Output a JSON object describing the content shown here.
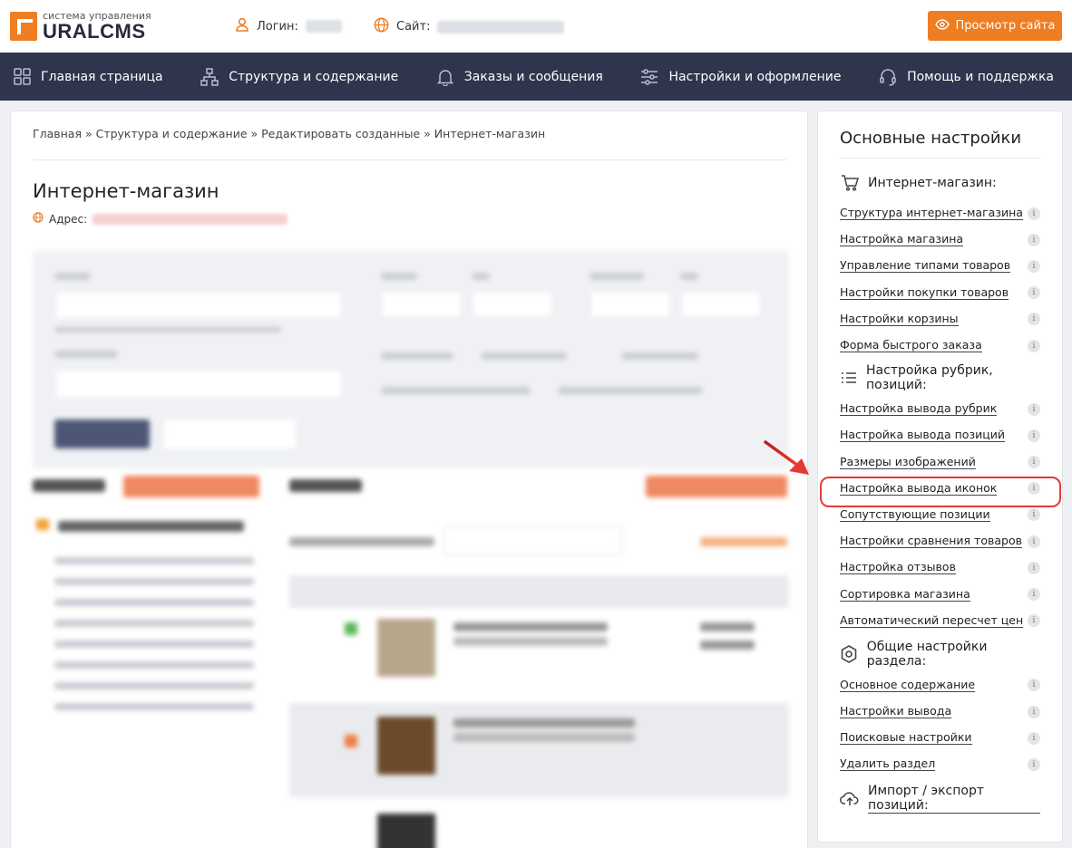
{
  "header": {
    "logo_sub": "система управления",
    "logo_main": "URALCMS",
    "login_label": "Логин:",
    "site_label": "Сайт:",
    "view_site": "Просмотр сайта"
  },
  "nav": [
    {
      "label": "Главная страница",
      "icon": "grid-icon"
    },
    {
      "label": "Структура и содержание",
      "icon": "sitemap-icon"
    },
    {
      "label": "Заказы и сообщения",
      "icon": "bell-icon"
    },
    {
      "label": "Настройки и оформление",
      "icon": "sliders-icon"
    },
    {
      "label": "Помощь и поддержка",
      "icon": "headset-icon"
    }
  ],
  "main": {
    "breadcrumb": "Главная » Структура и содержание » Редактировать созданные » Интернет-магазин",
    "title": "Интернет-магазин",
    "address_label": "Адрес:"
  },
  "sidebar": {
    "title": "Основные настройки",
    "sections": [
      {
        "title": "Интернет-магазин:",
        "icon": "cart-icon",
        "links": [
          "Структура интернет-магазина",
          "Настройка магазина",
          "Управление типами товаров",
          "Настройки покупки товаров",
          "Настройки корзины",
          "Форма быстрого заказа"
        ]
      },
      {
        "title": "Настройка рубрик, позиций:",
        "icon": "list-icon",
        "links": [
          "Настройка вывода рубрик",
          "Настройка вывода позиций",
          "Размеры изображений",
          "Настройка вывода иконок",
          "Сопутствующие позиции",
          "Настройки сравнения товаров",
          "Настройка отзывов",
          "Сортировка магазина",
          "Автоматический пересчет цен"
        ]
      },
      {
        "title": "Общие настройки раздела:",
        "icon": "hexagon-gear-icon",
        "links": [
          "Основное содержание",
          "Настройки вывода",
          "Поисковые настройки",
          "Удалить раздел"
        ]
      }
    ],
    "import_export": "Импорт / экспорт позиций:",
    "highlighted": "Настройка вывода иконок"
  },
  "colors": {
    "accent": "#ef7d22",
    "nav_bg": "#2e354c",
    "highlight": "#e53935"
  }
}
